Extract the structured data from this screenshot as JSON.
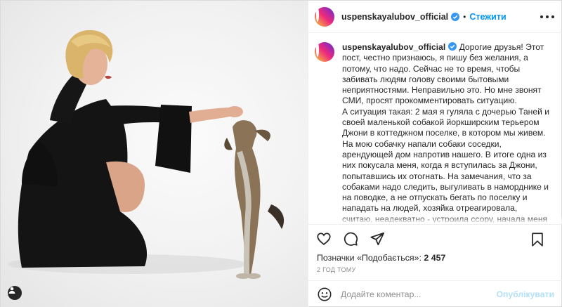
{
  "post": {
    "username": "uspenskayalubov_official",
    "follow_label": "Стежити",
    "separator": "•",
    "caption_paragraphs": [
      "Дорогие друзья! Этот пост, честно признаюсь, я пишу без желания, а потому, что надо. Сейчас не то время, чтобы забивать людям голову своими бытовыми неприятностями. Неправильно это. Но мне звонят СМИ, просят прокомментировать ситуацию.",
      "А ситуация такая: 2 мая я гуляла с дочерью Таней и своей маленькой собакой йоркширским терьером Джони в коттеджном поселке, в котором мы живем. На мою собачку напали собаки соседки, арендующей дом напротив нашего. В итоге одна из них покусала меня, когда я вступилась за Джони, попытавшись их отогнать. На замечания, что за собаками надо следить, выгуливать в наморднике и на поводке, а не отпускать бегать по поселку и нападать на людей, хозяйка отреагировала, считаю, неадекватно - устроила ссору, начала меня провоцировать. Был бытовой, как говорят, конфликт. Я, конечно, была возмущена такой реакцией соседки и по-русски сказала, что я обо всем этом думаю. В поселке эта дама, как выяснилось, не на хорошем счету - на нее неоднократно жаловались жильцы. По поводу"
    ],
    "likes_label": "Позначки «Подобається»: ",
    "likes_count": "2 457",
    "timestamp": "2 ГОД ТОМУ",
    "comment_placeholder": "Додайте коментар...",
    "publish_label": "Опублікувати"
  },
  "icons": {
    "verified": "verified-badge-icon",
    "more": "more-options-icon",
    "like": "heart-icon",
    "comment": "comment-bubble-icon",
    "share": "paper-plane-icon",
    "save": "bookmark-icon",
    "emoji": "emoji-smile-icon",
    "user_tag": "user-tag-icon"
  },
  "colors": {
    "link_blue": "#0095f6",
    "publish_disabled": "#b2dffc",
    "text": "#262626",
    "muted": "#8e8e8e",
    "border": "#efefef"
  }
}
